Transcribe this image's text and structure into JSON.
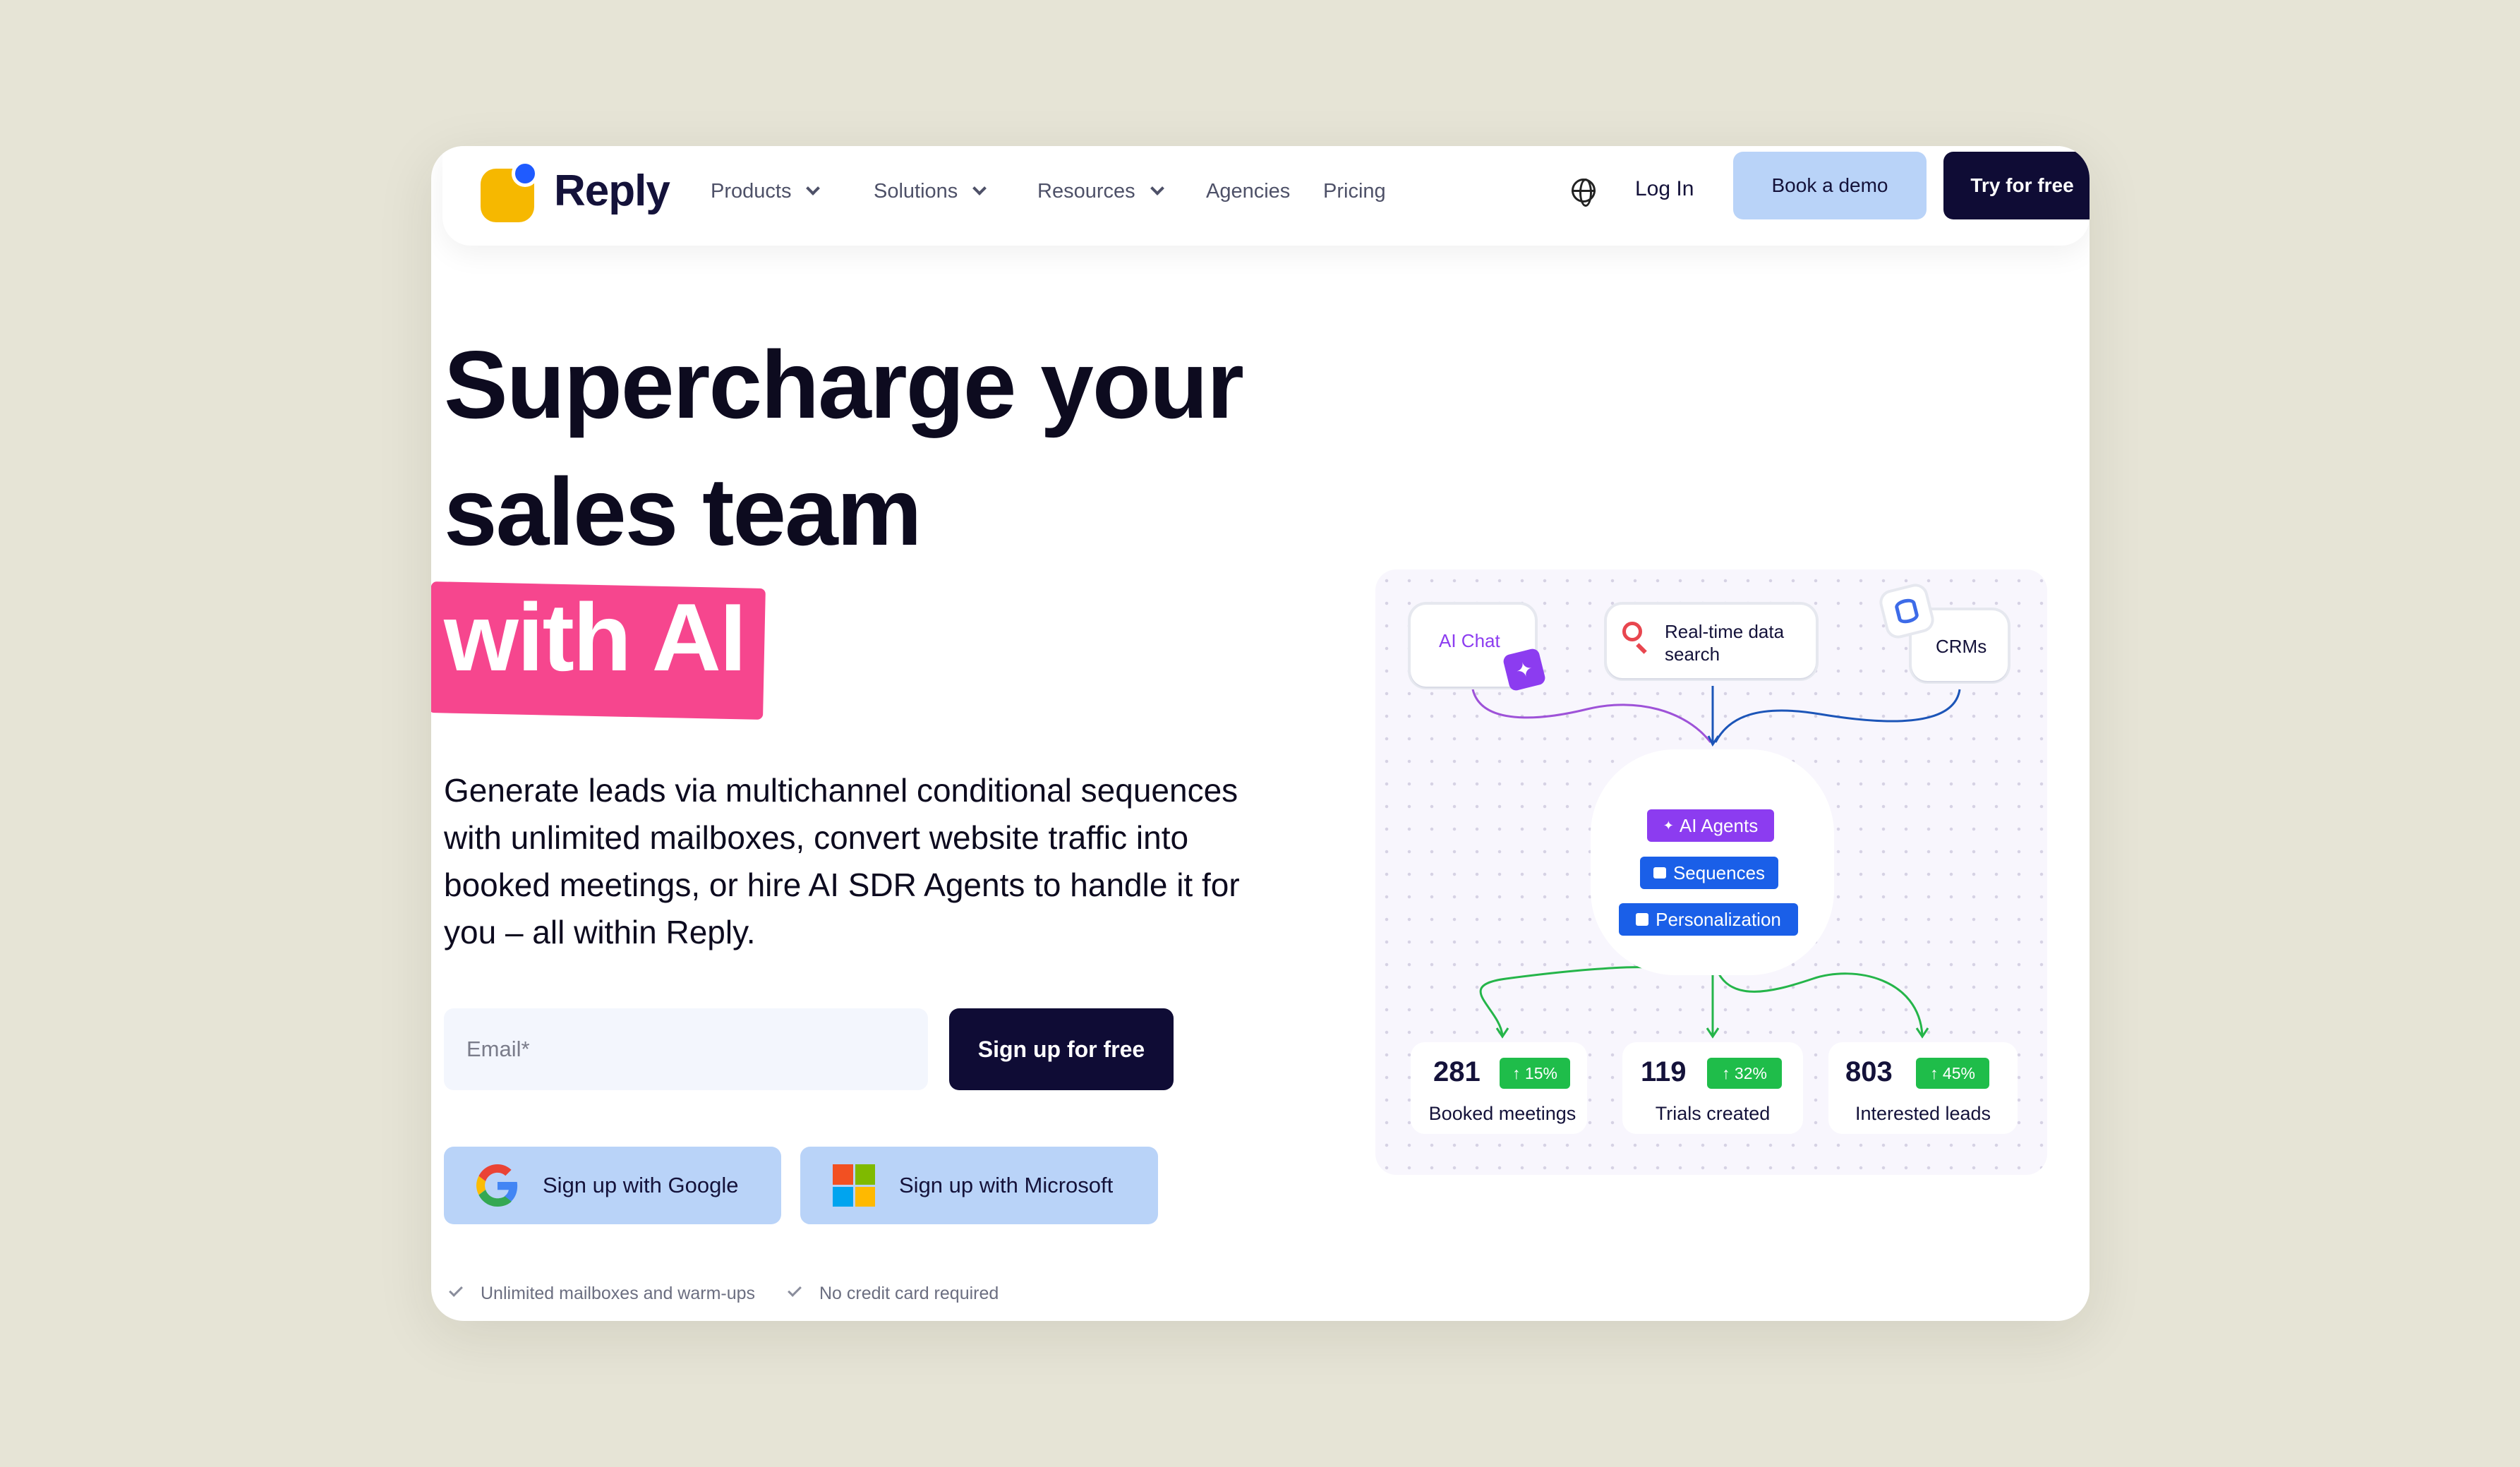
{
  "nav": {
    "logo": "Reply",
    "items": [
      {
        "label": "Products",
        "has_dropdown": true
      },
      {
        "label": "Solutions",
        "has_dropdown": true
      },
      {
        "label": "Resources",
        "has_dropdown": true
      },
      {
        "label": "Agencies",
        "has_dropdown": false
      },
      {
        "label": "Pricing",
        "has_dropdown": false
      }
    ],
    "language_icon": "globe-icon",
    "login": "Log In",
    "book_demo": "Book a demo",
    "try_free": "Try for free"
  },
  "hero": {
    "line1": "Supercharge your",
    "line2": "sales team",
    "highlight": "with AI",
    "description": "Generate leads via multichannel conditional sequences with unlimited mailboxes, convert website traffic into booked meetings, or hire AI SDR Agents to handle it for you – all within Reply."
  },
  "form": {
    "email_placeholder": "Email*",
    "signup_button": "Sign up for free",
    "google_button": "Sign up with Google",
    "microsoft_button": "Sign up with Microsoft"
  },
  "checks": [
    "Unlimited mailboxes and warm-ups",
    "No credit card required"
  ],
  "diagram": {
    "sources": [
      "AI Chat",
      "Real-time data search",
      "CRMs"
    ],
    "core_tags": [
      "AI Agents",
      "Sequences",
      "Personalization"
    ],
    "stats": [
      {
        "value": "281",
        "change": "15%",
        "label": "Booked meetings"
      },
      {
        "value": "119",
        "change": "32%",
        "label": "Trials created"
      },
      {
        "value": "803",
        "change": "45%",
        "label": "Interested leads"
      }
    ]
  },
  "colors": {
    "brand_dark": "#0f0c35",
    "accent_blue": "#b9d3f8",
    "highlight_pink": "#f6468e",
    "logo_yellow": "#f6b800",
    "logo_blue": "#1f5bff",
    "tag_purple": "#8c3cf0",
    "tag_blue": "#1a5fe8",
    "stat_green": "#1fbd4a"
  }
}
